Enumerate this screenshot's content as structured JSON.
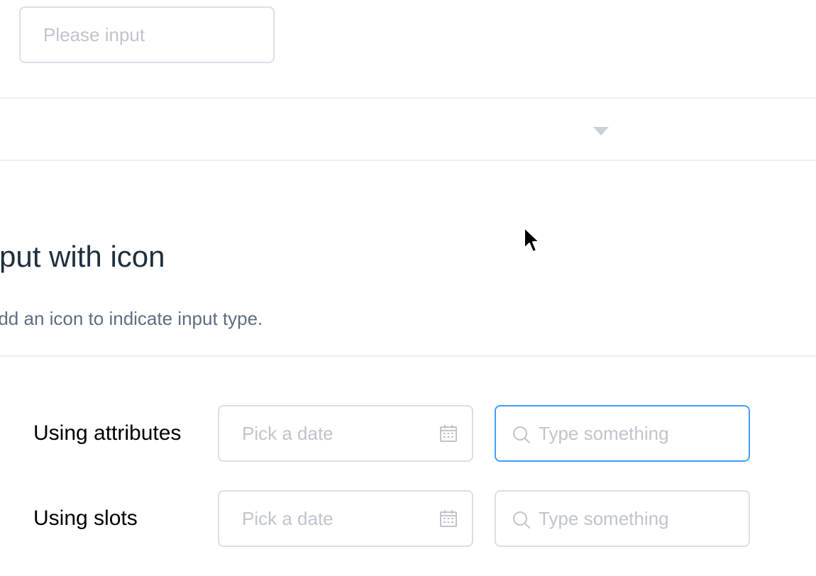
{
  "top_input": {
    "placeholder": "Please input"
  },
  "section": {
    "title": "Input with icon",
    "description": "Add an icon to indicate input type."
  },
  "rows": [
    {
      "label": "Using attributes",
      "date_placeholder": "Pick a date",
      "search_placeholder": "Type something",
      "search_focused": true
    },
    {
      "label": "Using slots",
      "date_placeholder": "Pick a date",
      "search_placeholder": "Type something",
      "search_focused": false
    }
  ],
  "icons": {
    "date": "calendar-icon",
    "search": "search-icon",
    "dropdown": "caret-down-icon"
  },
  "colors": {
    "border": "#dcdfe6",
    "focus_border": "#409eff",
    "placeholder": "#c0c4cc",
    "heading": "#1f2f3d",
    "description": "#5e6d82"
  }
}
